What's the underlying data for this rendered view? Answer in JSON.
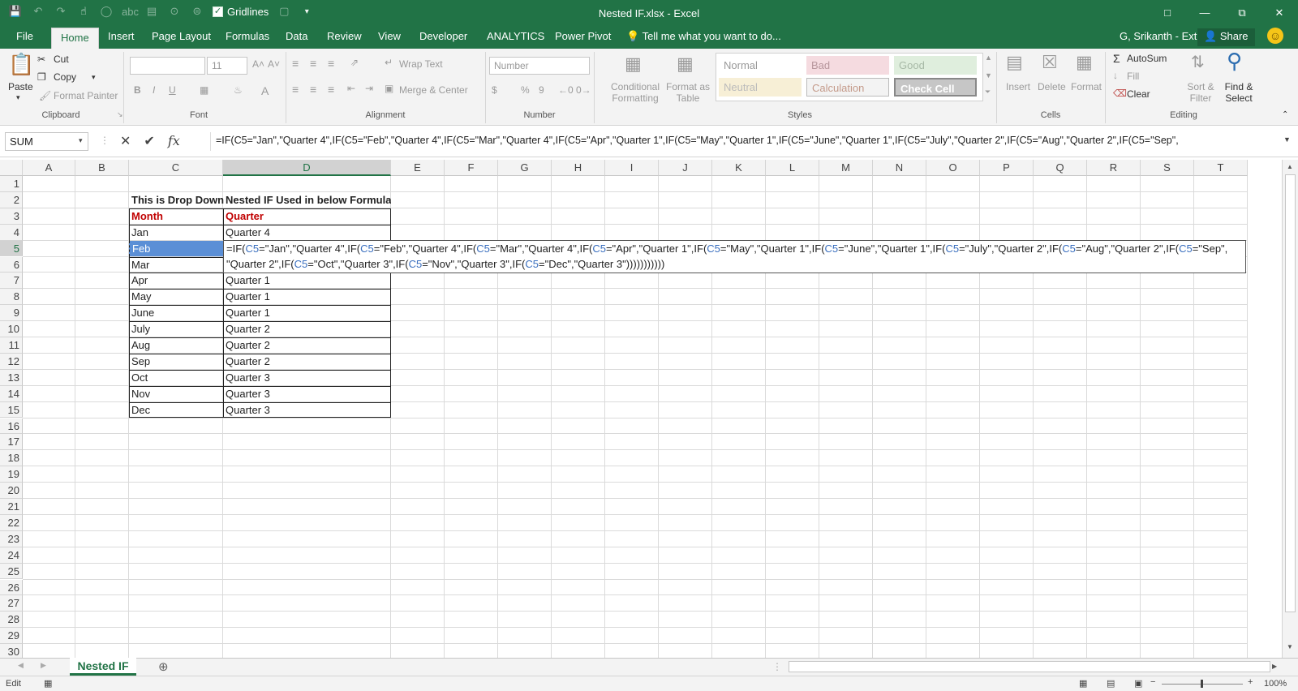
{
  "window": {
    "title": "Nested IF.xlsx - Excel",
    "gridlines_label": "Gridlines",
    "gridlines_checked": true
  },
  "tabs": [
    "File",
    "Home",
    "Insert",
    "Page Layout",
    "Formulas",
    "Data",
    "Review",
    "View",
    "Developer",
    "ANALYTICS",
    "Power Pivot"
  ],
  "active_tab": "Home",
  "tell_me": "Tell me what you want to do...",
  "user": "G, Srikanth - Ext",
  "share_label": "Share",
  "ribbon": {
    "clipboard": {
      "paste": "Paste",
      "cut": "Cut",
      "copy": "Copy",
      "format_painter": "Format Painter",
      "label": "Clipboard"
    },
    "font": {
      "size": "11",
      "label": "Font",
      "bold": "B",
      "italic": "I",
      "underline": "U",
      "grow": "A˄",
      "shrink": "A˅"
    },
    "alignment": {
      "wrap_text": "Wrap Text",
      "merge_center": "Merge & Center",
      "label": "Alignment"
    },
    "number": {
      "format": "Number",
      "label": "Number",
      "currency": "$",
      "percent": "%",
      "comma": "9"
    },
    "styles": {
      "conditional_formatting": [
        "Conditional",
        "Formatting"
      ],
      "format_as_table": [
        "Format as",
        "Table"
      ],
      "normal": "Normal",
      "bad": "Bad",
      "good": "Good",
      "neutral": "Neutral",
      "calculation": "Calculation",
      "check_cell": "Check Cell",
      "label": "Styles"
    },
    "cells": {
      "insert": "Insert",
      "delete": "Delete",
      "format": "Format",
      "label": "Cells"
    },
    "editing": {
      "autosum": "AutoSum",
      "fill": "Fill",
      "clear": "Clear",
      "sort_filter": [
        "Sort &",
        "Filter"
      ],
      "find_select": [
        "Find &",
        "Select"
      ],
      "label": "Editing"
    }
  },
  "formula_bar": {
    "name_box": "SUM",
    "cancel": "✕",
    "enter": "✔",
    "fx": "fx",
    "formula": "=IF(C5=\"Jan\",\"Quarter 4\",IF(C5=\"Feb\",\"Quarter 4\",IF(C5=\"Mar\",\"Quarter 4\",IF(C5=\"Apr\",\"Quarter 1\",IF(C5=\"May\",\"Quarter 1\",IF(C5=\"June\",\"Quarter 1\",IF(C5=\"July\",\"Quarter 2\",IF(C5=\"Aug\",\"Quarter 2\",IF(C5=\"Sep\","
  },
  "columns": [
    "A",
    "B",
    "C",
    "D",
    "E",
    "F",
    "G",
    "H",
    "I",
    "J",
    "K",
    "L",
    "M",
    "N",
    "O",
    "P",
    "Q",
    "R",
    "S",
    "T"
  ],
  "rows": [
    "1",
    "2",
    "3",
    "4",
    "5",
    "6",
    "7",
    "8",
    "9",
    "10",
    "11",
    "12",
    "13",
    "14",
    "15",
    "16",
    "17",
    "18",
    "19",
    "20",
    "21",
    "22",
    "23",
    "24",
    "25",
    "26",
    "27",
    "28",
    "29",
    "30"
  ],
  "sheet": {
    "c2": "This is Drop Down",
    "d2": "Nested IF Used in below Formula",
    "c3": "Month",
    "d3": "Quarter",
    "table": [
      {
        "month": "Jan",
        "quarter": "Quarter 4"
      },
      {
        "month": "Feb",
        "quarter": ""
      },
      {
        "month": "Mar",
        "quarter": ""
      },
      {
        "month": "Apr",
        "quarter": "Quarter 1"
      },
      {
        "month": "May",
        "quarter": "Quarter 1"
      },
      {
        "month": "June",
        "quarter": "Quarter 1"
      },
      {
        "month": "July",
        "quarter": "Quarter 2"
      },
      {
        "month": "Aug",
        "quarter": "Quarter 2"
      },
      {
        "month": "Sep",
        "quarter": "Quarter 2"
      },
      {
        "month": "Oct",
        "quarter": "Quarter 3"
      },
      {
        "month": "Nov",
        "quarter": "Quarter 3"
      },
      {
        "month": "Dec",
        "quarter": "Quarter 3"
      }
    ],
    "edit_line1": [
      [
        "=IF(",
        ""
      ],
      [
        "C5",
        "ref"
      ],
      [
        "=\"Jan\",\"Quarter 4\",IF(",
        ""
      ],
      [
        "C5",
        "ref"
      ],
      [
        "=\"Feb\",\"Quarter 4\",IF(",
        ""
      ],
      [
        "C5",
        "ref"
      ],
      [
        "=\"Mar\",\"Quarter 4\",IF(",
        ""
      ],
      [
        "C5",
        "ref"
      ],
      [
        "=\"Apr\",\"Quarter 1\",IF(",
        ""
      ],
      [
        "C5",
        "ref"
      ],
      [
        "=\"May\",\"Quarter 1\",IF(",
        ""
      ],
      [
        "C5",
        "ref"
      ],
      [
        "=\"June\",\"Quarter 1\",IF(",
        ""
      ],
      [
        "C5",
        "ref"
      ],
      [
        "=\"July\",\"Quarter 2\",IF(",
        ""
      ],
      [
        "C5",
        "ref"
      ],
      [
        "=\"Aug\",\"Quarter 2\",IF(",
        ""
      ],
      [
        "C5",
        "ref"
      ],
      [
        "=\"Sep\",",
        ""
      ]
    ],
    "edit_line2": [
      [
        "\"Quarter 2\",IF(",
        ""
      ],
      [
        "C5",
        "ref"
      ],
      [
        "=\"Oct\",\"Quarter 3\",IF(",
        ""
      ],
      [
        "C5",
        "ref"
      ],
      [
        "=\"Nov\",\"Quarter 3\",IF(",
        ""
      ],
      [
        "C5",
        "ref"
      ],
      [
        "=\"Dec\",\"Quarter 3\")))))))))))",
        ""
      ]
    ]
  },
  "sheet_tab": "Nested IF",
  "status": {
    "mode": "Edit",
    "zoom": "100%"
  },
  "colors": {
    "excel_green": "#217346",
    "header_red": "#c00000",
    "ref_blue": "#3a6fbf",
    "selection": "#5b8fd6"
  }
}
